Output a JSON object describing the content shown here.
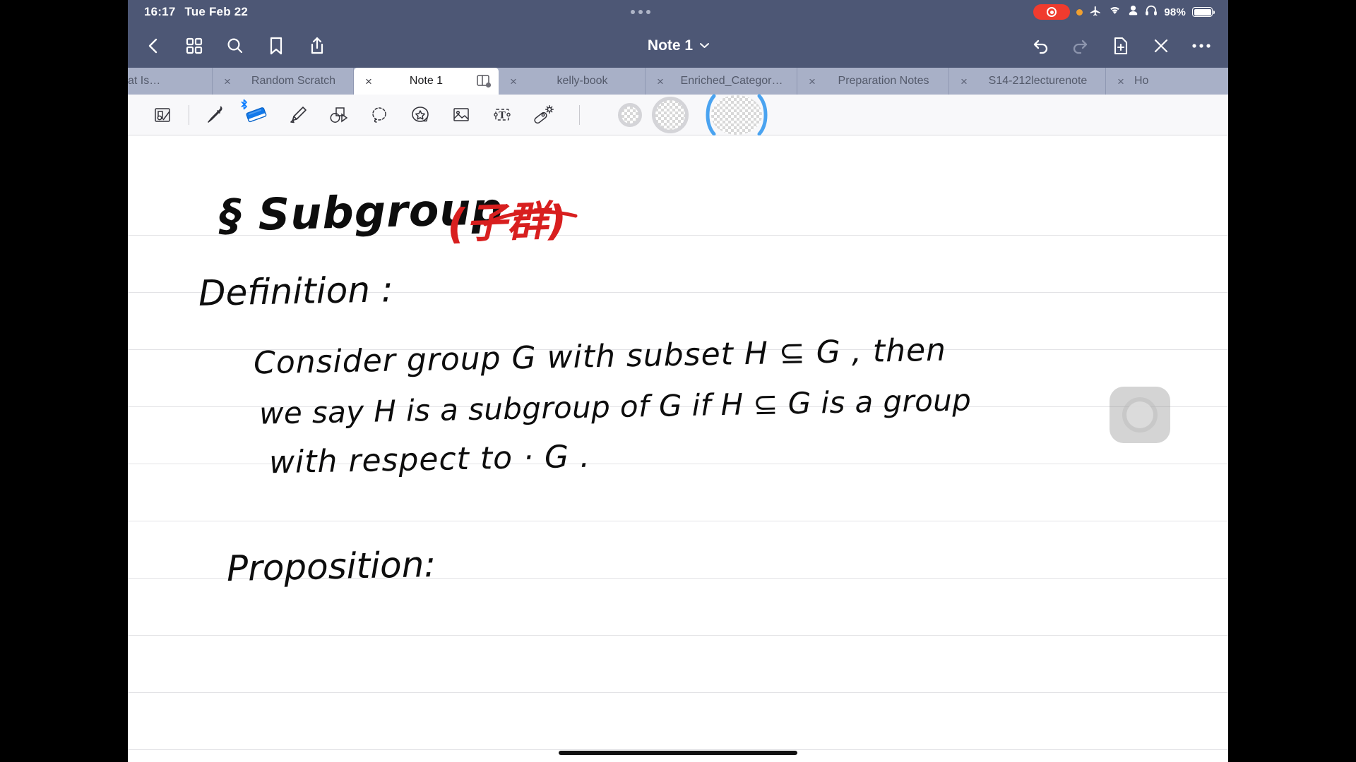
{
  "status_bar": {
    "time": "16:17",
    "date": "Tue Feb 22",
    "battery_percent": "98%",
    "icons": [
      "screen-recording-indicator",
      "orange-privacy-dot",
      "airplane-mode-icon",
      "wifi-icon",
      "person-icon",
      "headphones-icon",
      "battery-icon"
    ],
    "colors": {
      "bar_background": "#4d5775",
      "recording_red": "#f03b2e",
      "privacy_orange": "#f0a030"
    }
  },
  "nav_bar": {
    "title": "Note 1",
    "left_icons": [
      "back-chevron-icon",
      "grid-icon",
      "search-icon",
      "bookmark-icon",
      "share-icon"
    ],
    "right_icons": [
      "undo-icon",
      "redo-icon",
      "new-page-icon",
      "close-icon",
      "more-icon"
    ]
  },
  "tabs": [
    {
      "label": "What Is…",
      "active": false,
      "clipped": true
    },
    {
      "label": "Random Scratch",
      "active": false
    },
    {
      "label": "Note 1",
      "active": true
    },
    {
      "label": "kelly-book",
      "active": false
    },
    {
      "label": "Enriched_Categor…",
      "active": false
    },
    {
      "label": "Preparation Notes",
      "active": false
    },
    {
      "label": "S14-212lecturenote",
      "active": false
    },
    {
      "label": "Ho",
      "active": false,
      "clipped": true
    }
  ],
  "tools": [
    {
      "name": "page-tool",
      "selected": false
    },
    {
      "name": "pen-tool",
      "selected": false
    },
    {
      "name": "eraser-tool",
      "selected": true,
      "badge": "bluetooth"
    },
    {
      "name": "highlighter-tool",
      "selected": false
    },
    {
      "name": "shapes-tool",
      "selected": false
    },
    {
      "name": "lasso-tool",
      "selected": false
    },
    {
      "name": "sticker-tool",
      "selected": false
    },
    {
      "name": "image-tool",
      "selected": false
    },
    {
      "name": "text-tool",
      "selected": false
    },
    {
      "name": "magic-wand-tool",
      "selected": false
    }
  ],
  "eraser_sizes": [
    {
      "name": "eraser-size-small",
      "selected": false
    },
    {
      "name": "eraser-size-medium",
      "selected": false
    },
    {
      "name": "eraser-size-large",
      "selected": true
    }
  ],
  "note_content": {
    "heading": "§ Subgroup",
    "heading_annotation": "(子群)",
    "heading_annotation_color": "#d81f1f",
    "definition_label": "Definition :",
    "definition_lines": [
      "Consider group G with subset H ⊆ G , then",
      "we say H is a subgroup of G if H ⊆ G is a group",
      "with respect to · G ."
    ],
    "proposition_label": "Proposition:"
  },
  "overlay": {
    "assistive_touch": "assistive-touch-button"
  }
}
